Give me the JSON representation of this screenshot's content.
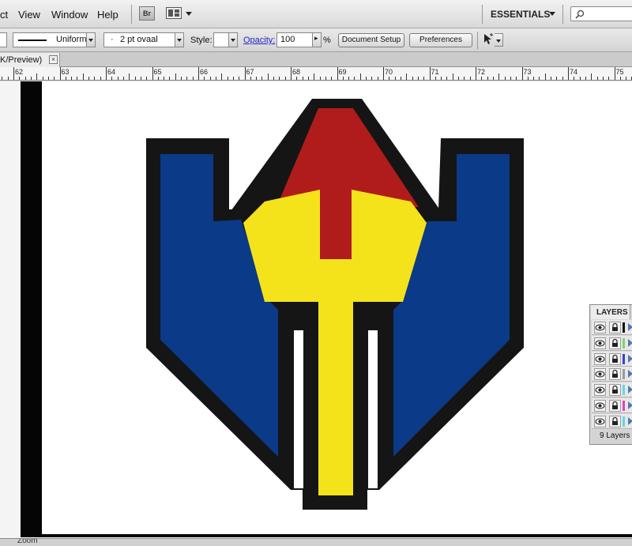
{
  "menu": {
    "items": [
      "ct",
      "View",
      "Window",
      "Help"
    ],
    "bridge_label": "Br",
    "workspace": "ESSENTIALS"
  },
  "control": {
    "stroke_profile": "Uniform",
    "brush_bullet": "·",
    "brush": "2 pt ovaal",
    "style_label": "Style:",
    "opacity_label": "Opacity:",
    "opacity_value": "100",
    "opacity_unit": "%",
    "document_setup": "Document Setup",
    "preferences": "Preferences"
  },
  "doc_tab": {
    "label": "K/Preview)",
    "close": "×"
  },
  "ruler": {
    "labels": [
      "62",
      "63",
      "64",
      "65",
      "66",
      "67",
      "68",
      "69",
      "70",
      "71",
      "72",
      "73",
      "74",
      "75"
    ]
  },
  "artwork": {
    "colors": {
      "outline": "#151515",
      "blue": "#0a3a88",
      "red": "#b01c1c",
      "yellow": "#f4e31b"
    }
  },
  "layers": {
    "title": "LAYERS",
    "rows": [
      {
        "color": "#111111"
      },
      {
        "color": "#7ad66b"
      },
      {
        "color": "#3d3dd8"
      },
      {
        "color": "#9a9a9a"
      },
      {
        "color": "#5fd8e0"
      },
      {
        "color": "#e040c8"
      },
      {
        "color": "#5fd8e0"
      }
    ],
    "footer": "9 Layers"
  },
  "status": {
    "zoom_label": "Zoom"
  }
}
